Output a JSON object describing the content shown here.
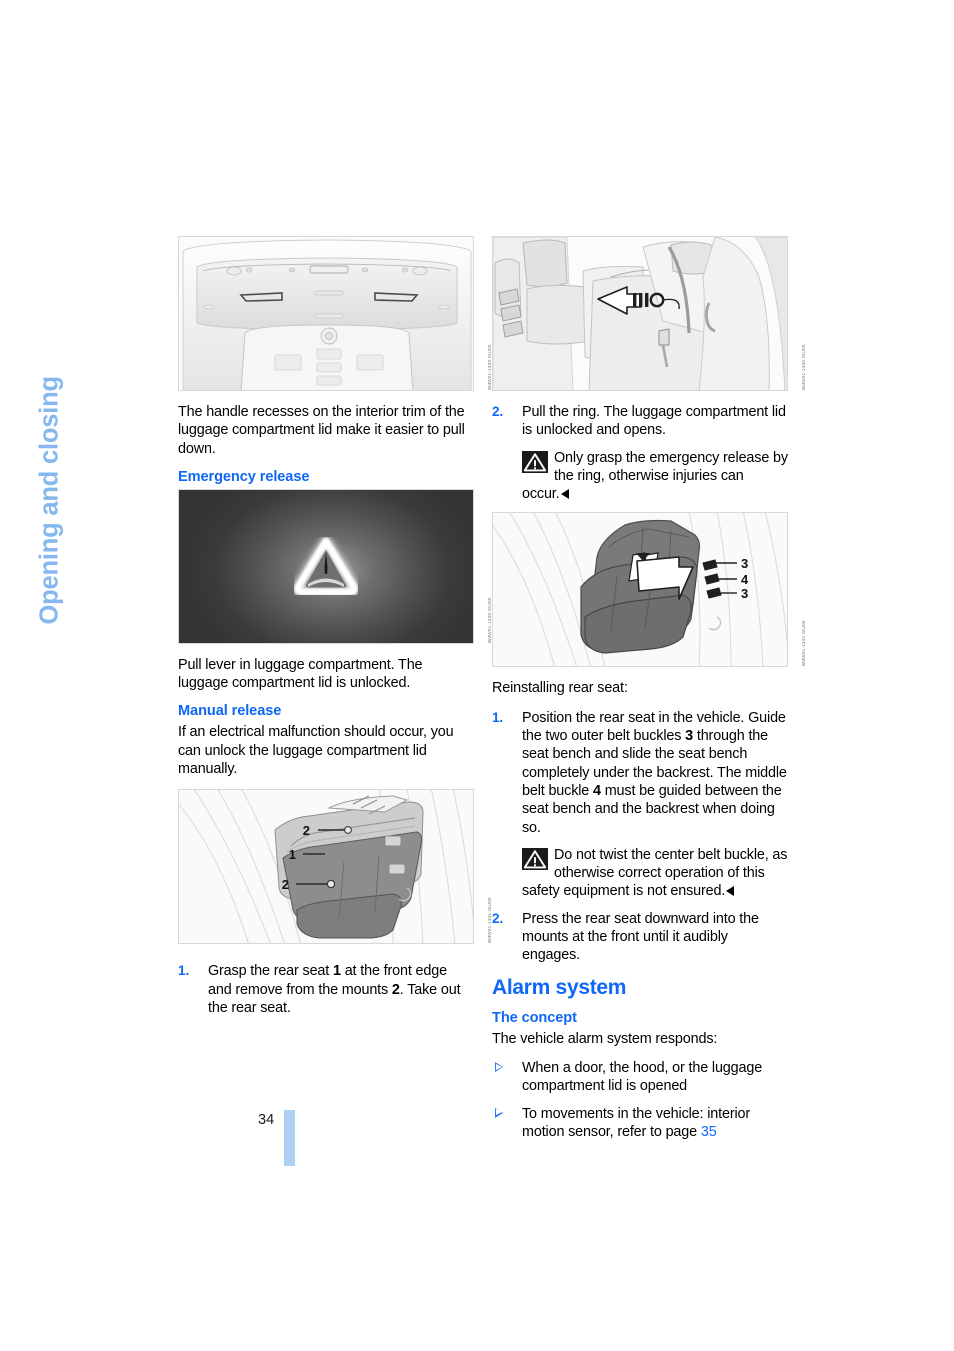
{
  "chapter": {
    "title": "Opening and closing"
  },
  "page": {
    "number": "34"
  },
  "figures": {
    "trim_handle_recesses": {
      "name": "luggage-compartment-lid-interior-trim",
      "code": "BMW01-1339-SIU00"
    },
    "emergency_release_photo": {
      "name": "emergency-release-glow-handle",
      "code": "BMW01-1338-SIU00"
    },
    "manual_release_seat": {
      "name": "rear-seat-removal-mounts",
      "code": "BMW01-1341-SIU00",
      "callouts": [
        "2",
        "1",
        "2"
      ]
    },
    "pull_ring": {
      "name": "emergency-release-ring-pull",
      "code": "BMW01-1340-SIU00"
    },
    "reinstall_seat": {
      "name": "rear-seat-belt-buckles",
      "code": "BMW01-1342-SIU00",
      "callouts": [
        "3",
        "4",
        "3"
      ]
    }
  },
  "left_column": {
    "intro_paragraph": "The handle recesses on the interior trim of the luggage compartment lid make it easier to pull down.",
    "emergency_release_heading": "Emergency release",
    "emergency_release_paragraph": "Pull lever in luggage compartment. The luggage compartment lid is unlocked.",
    "manual_release_heading": "Manual release",
    "manual_release_paragraph": "If an electrical malfunction should occur, you can unlock the luggage compartment lid manually.",
    "step_1": {
      "number": "1.",
      "text_a": "Grasp the rear seat ",
      "bold_a": "1",
      "text_b": " at the front edge and remove from the mounts ",
      "bold_b": "2",
      "text_c": ". Take out the rear seat."
    }
  },
  "right_column": {
    "step_2": {
      "number": "2.",
      "text": "Pull the ring. The luggage compartment lid is unlocked and opens."
    },
    "warning_1": {
      "icon": "warning-triangle-icon",
      "text": "Only grasp the emergency release by the ring, otherwise injuries can",
      "tail": "occur."
    },
    "reinstall_intro": "Reinstalling rear seat:",
    "reinstall_step_1": {
      "number": "1.",
      "text_a": "Position the rear seat in the vehicle. Guide the two outer belt buckles ",
      "bold_a": "3",
      "text_b": " through the seat bench and slide the seat bench completely under the backrest. The middle belt buckle ",
      "bold_b": "4",
      "text_c": " must be guided between the seat bench and the backrest when doing so."
    },
    "warning_2": {
      "icon": "warning-triangle-icon",
      "text": "Do not twist the center belt buckle, as otherwise correct operation of this",
      "tail": "safety equipment is not ensured."
    },
    "reinstall_step_2": {
      "number": "2.",
      "text": "Press the rear seat downward into the mounts at the front until it audibly engages."
    },
    "alarm_heading": "Alarm system",
    "concept_heading": "The concept",
    "concept_paragraph": "The vehicle alarm system responds:",
    "bullets": [
      {
        "text": "When a door, the hood, or the luggage compartment lid is opened"
      },
      {
        "text_a": "To movements in the vehicle: interior motion sensor, refer to page ",
        "link": "35"
      }
    ]
  },
  "colors": {
    "heading_blue": "#0f68f5",
    "chapter_blue": "#85b8ee",
    "page_bar_blue": "#aed0f5",
    "bullet_blue": "#2f7cf6"
  }
}
